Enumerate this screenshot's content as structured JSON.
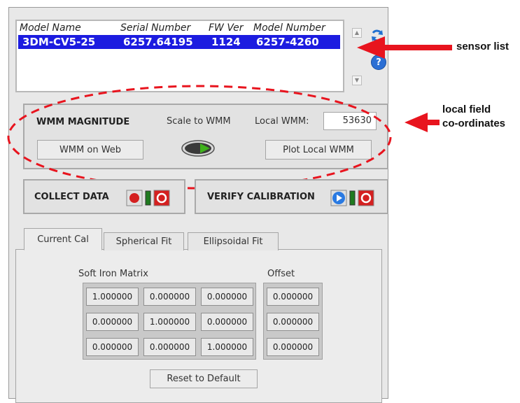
{
  "sensor_list": {
    "headers": [
      "Model Name",
      "Serial Number",
      "FW Ver",
      "Model Number"
    ],
    "rows": [
      [
        "3DM-CV5-25",
        "6257.64195",
        "1124",
        "6257-4260"
      ]
    ]
  },
  "wmm": {
    "title": "WMM MAGNITUDE",
    "scale_label": "Scale to WMM",
    "local_label": "Local WMM:",
    "local_value": "53630",
    "web_button": "WMM on Web",
    "plot_button": "Plot Local WMM"
  },
  "collect": {
    "label": "COLLECT DATA"
  },
  "verify": {
    "label": "VERIFY CALIBRATION"
  },
  "tabs": [
    "Current Cal",
    "Spherical Fit",
    "Ellipsoidal Fit"
  ],
  "calibration": {
    "soft_iron_label": "Soft Iron Matrix",
    "offset_label": "Offset",
    "soft_iron": [
      [
        "1.000000",
        "0.000000",
        "0.000000"
      ],
      [
        "0.000000",
        "1.000000",
        "0.000000"
      ],
      [
        "0.000000",
        "0.000000",
        "1.000000"
      ]
    ],
    "offset": [
      "0.000000",
      "0.000000",
      "0.000000"
    ],
    "reset_button": "Reset to Default"
  },
  "annotations": {
    "sensor_list": "sensor list",
    "local_field_1": "local field",
    "local_field_2": "co-ordinates"
  },
  "colors": {
    "selection": "#1c1ce0",
    "annotation": "#e8141e",
    "refresh_icon": "#1f6fd0",
    "record_icon": "#d42020",
    "play_icon": "#2a7ae2"
  },
  "icons": [
    "refresh-icon",
    "help-icon",
    "record-icon",
    "stop-icon",
    "play-icon",
    "toggle-switch-icon",
    "arrow-icon"
  ]
}
